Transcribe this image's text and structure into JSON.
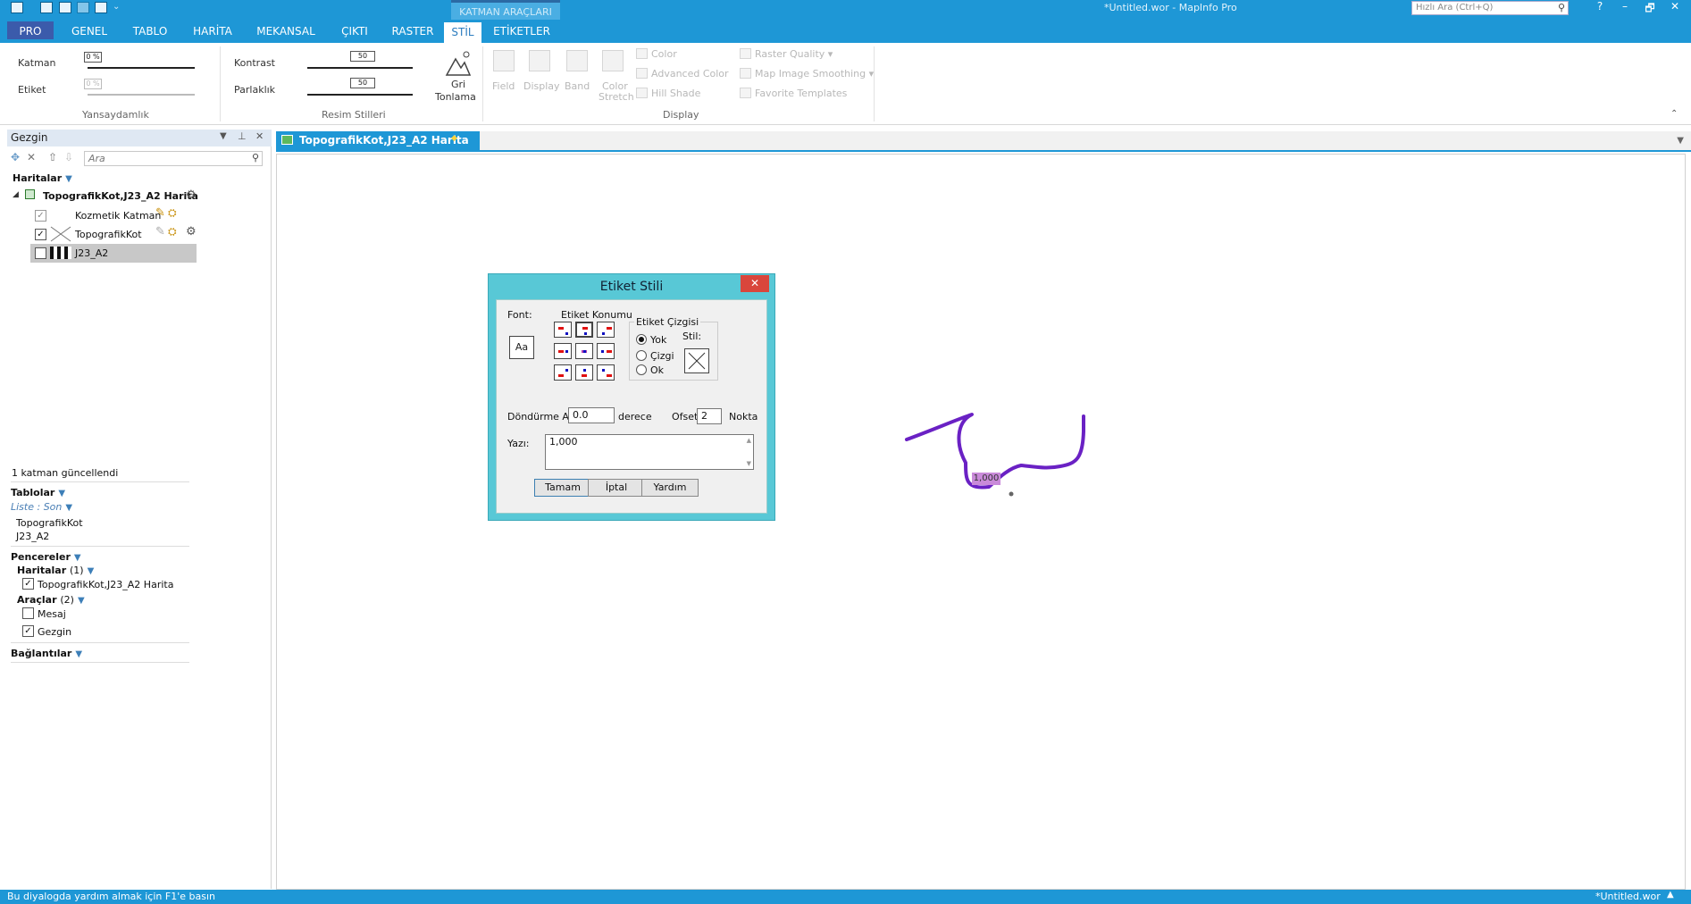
{
  "window": {
    "title": "*Untitled.wor - MapInfo Pro",
    "context_tab_title": "KATMAN ARAÇLARI",
    "quick_search_placeholder": "Hızlı Ara (Ctrl+Q)",
    "help": "?",
    "minimize": "–",
    "restore": "🗗",
    "close": "✕"
  },
  "tabs": [
    "PRO",
    "GENEL",
    "TABLO",
    "HARİTA",
    "MEKANSAL",
    "ÇIKTI",
    "RASTER",
    "STİL",
    "ETİKETLER"
  ],
  "ribbon": {
    "transparency": {
      "group_label": "Yansaydamlık",
      "layer_label": "Katman",
      "layer_value": "0 %",
      "label_label": "Etiket",
      "label_value": "0 %"
    },
    "image_styles": {
      "group_label": "Resim Stilleri",
      "contrast_label": "Kontrast",
      "contrast_value": "50",
      "brightness_label": "Parlaklık",
      "brightness_value": "50",
      "grayscale_label_1": "Gri",
      "grayscale_label_2": "Tonlama"
    },
    "display": {
      "group_label": "Display",
      "field": "Field",
      "display": "Display",
      "band": "Band",
      "color_stretch_1": "Color",
      "color_stretch_2": "Stretch",
      "color": "Color",
      "advanced_color": "Advanced Color",
      "hill_shade": "Hill Shade",
      "raster_quality": "Raster Quality ▾",
      "map_image_smoothing": "Map Image Smoothing ▾",
      "favorite_templates": "Favorite Templates"
    }
  },
  "navigator": {
    "title": "Gezgin",
    "search_placeholder": "Ara",
    "maps_header": "Haritalar",
    "map_name": "TopografikKot,J23_A2 Harita",
    "layers": [
      "Kozmetik Katman",
      "TopografikKot",
      "J23_A2"
    ],
    "status_message": "1 katman güncellendi",
    "tables_header": "Tablolar",
    "tables_list_label": "Liste : Son",
    "tables": [
      "TopografikKot",
      "J23_A2"
    ],
    "windows_header": "Pencereler",
    "windows_maps_label": "Haritalar",
    "windows_maps_count": "(1)",
    "windows_map_item": "TopografikKot,J23_A2 Harita",
    "tools_label": "Araçlar",
    "tools_count": "(2)",
    "tools": [
      "Mesaj",
      "Gezgin"
    ],
    "connections_header": "Bağlantılar"
  },
  "document": {
    "tab_title": "TopografikKot,J23_A2 Harita",
    "map_label": "1,000"
  },
  "dialog": {
    "title": "Etiket Stili",
    "font_label": "Font:",
    "font_button": "Aa",
    "position_label": "Etiket Konumu",
    "line_group_label": "Etiket Çizgisi",
    "style_label": "Stil:",
    "line_options": [
      "Yok",
      "Çizgi",
      "Ok"
    ],
    "rotation_label": "Döndürme Açısı:",
    "rotation_value": "0.0",
    "rotation_unit": "derece",
    "offset_label": "Ofset",
    "offset_value": "2",
    "offset_unit": "Nokta",
    "text_label": "Yazı:",
    "text_value": "1,000",
    "ok": "Tamam",
    "cancel": "İptal",
    "help": "Yardım"
  },
  "statusbar": {
    "help_text": "Bu diyalogda yardım almak için F1'e basın",
    "workspace": "*Untitled.wor"
  }
}
